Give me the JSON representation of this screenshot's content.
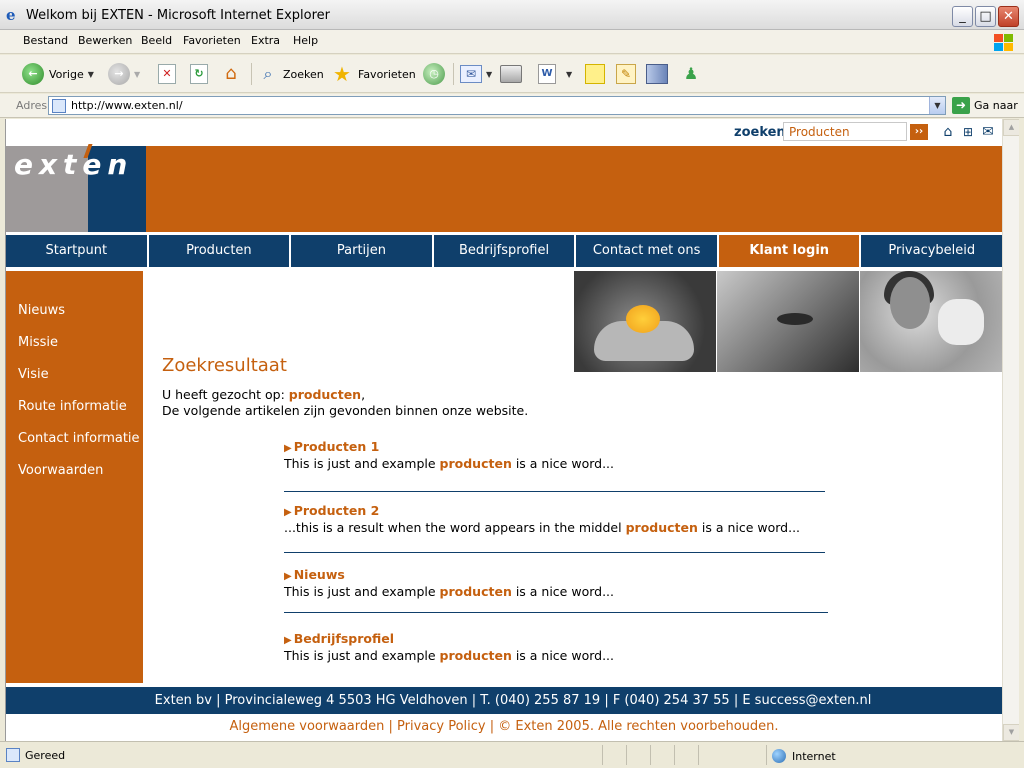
{
  "window": {
    "title": "Welkom bij EXTEN - Microsoft Internet Explorer",
    "minimize_icon": "minimize-icon",
    "maximize_icon": "maximize-icon",
    "close_icon": "close-icon"
  },
  "menu": [
    "Bestand",
    "Bewerken",
    "Beeld",
    "Favorieten",
    "Extra",
    "Help"
  ],
  "toolbar": {
    "back_label": "Vorige",
    "search_label": "Zoeken",
    "favorites_label": "Favorieten"
  },
  "address": {
    "label": "Adres",
    "url": "http://www.exten.nl/",
    "go_label": "Ga naar"
  },
  "site": {
    "search_label": "zoeken",
    "search_value": "Producten",
    "search_go": "››",
    "logo_text": "exten",
    "nav": [
      {
        "label": "Startpunt"
      },
      {
        "label": "Producten"
      },
      {
        "label": "Partijen"
      },
      {
        "label": "Bedrijfsprofiel"
      },
      {
        "label": "Contact met ons"
      },
      {
        "label": "Klant login"
      },
      {
        "label": "Privacybeleid"
      }
    ],
    "sidebar": [
      {
        "label": "Nieuws"
      },
      {
        "label": "Missie"
      },
      {
        "label": "Visie"
      },
      {
        "label": "Route informatie"
      },
      {
        "label": "Contact informatie"
      },
      {
        "label": "Voorwaarden"
      }
    ],
    "results": {
      "title": "Zoekresultaat",
      "query_prefix": "U heeft gezocht op: ",
      "query_term": "producten",
      "query_suffix": ",",
      "intro": "De volgende artikelen zijn gevonden binnen onze website.",
      "items": [
        {
          "title": "Producten 1",
          "before": "This is just and example ",
          "term": "producten",
          "after": " is a nice word..."
        },
        {
          "title": "Producten 2",
          "before": "...this is a result when the word appears in the middel ",
          "term": "producten",
          "after": " is a nice word..."
        },
        {
          "title": "Nieuws",
          "before": "This is just and example ",
          "term": "producten",
          "after": " is a nice word..."
        },
        {
          "title": "Bedrijfsprofiel",
          "before": "This is just and example ",
          "term": "producten",
          "after": " is a nice word..."
        }
      ]
    },
    "footer": {
      "address": "Exten bv | Provincialeweg 4 5503 HG Veldhoven | T. (040) 255 87 19 | F (040) 254 37 55 | E success@exten.nl",
      "legal": "Algemene voorwaarden | Privacy Policy | © Exten 2005. Alle rechten voorbehouden."
    }
  },
  "status": {
    "text": "Gereed",
    "zone": "Internet"
  },
  "colors": {
    "orange": "#c5600f",
    "navy": "#0f3f6b"
  }
}
